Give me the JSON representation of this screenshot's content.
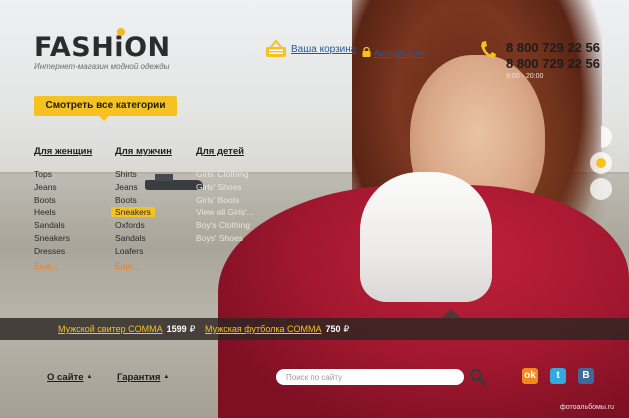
{
  "brand": {
    "logo_text_before": "FASH",
    "logo_i": "i",
    "logo_text_after": "ON",
    "tagline": "Интернет-магазин модной одежды"
  },
  "header": {
    "cart_label": "Ваша корзина",
    "auth_label": "Авторизация",
    "phone_1": "8 800 729 22 56",
    "phone_2": "8 800 729 22 56",
    "hours": "9:00 - 20:00"
  },
  "all_categories_button": "Смотреть все категории",
  "columns": {
    "women": {
      "title": "Для женщин",
      "items": [
        "Tops",
        "Jeans",
        "Boots",
        "Heels",
        "Sandals",
        "Sneakers",
        "Dresses"
      ],
      "more": "Еще..."
    },
    "men": {
      "title": "Для мужчин",
      "items": [
        "Shirts",
        "Jeans",
        "Boots",
        "Sneakers",
        "Oxfords",
        "Sandals",
        "Loafers"
      ],
      "active_index": 3,
      "more": "Еще..."
    },
    "kids": {
      "title": "Для детей",
      "items": [
        "Girls' Clothing",
        "Girls' Shoes",
        "Girls' Boots",
        "View all Girls'...",
        "Boy's Clothing",
        "Boys' Shoes"
      ]
    }
  },
  "promos": [
    {
      "name": "Мужской свитер COMMA",
      "price": "1599",
      "currency": "₽"
    },
    {
      "name": "Мужская футболка COMMA",
      "price": "750",
      "currency": "₽"
    }
  ],
  "footer": {
    "about": "О сайте",
    "warranty": "Гарантия",
    "search_placeholder": "Поиск по сайту",
    "social": {
      "ok": "ok",
      "twitter": "t",
      "vk": "B"
    },
    "watermark": "фотоальбомы.ru"
  },
  "colors": {
    "accent_yellow": "#f5c222",
    "link_blue": "#245a9a",
    "more_orange": "#f07f1e",
    "strip_dark": "#2d2622"
  },
  "icons": [
    "basket-icon",
    "lock-icon",
    "phone-icon",
    "search-icon",
    "odnoklassniki-icon",
    "twitter-icon",
    "vk-icon"
  ],
  "slider": {
    "current_slide": 2,
    "slide_count": 3
  }
}
